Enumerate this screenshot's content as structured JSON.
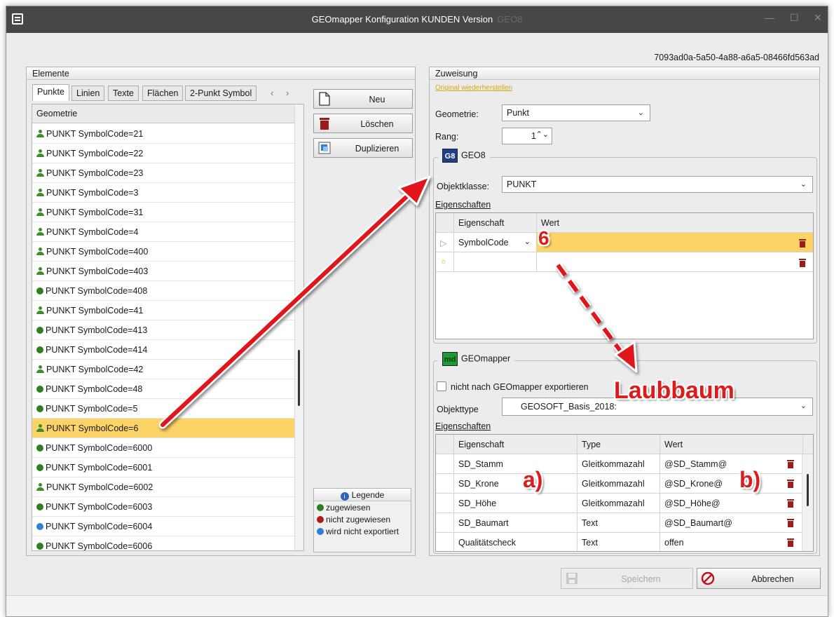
{
  "window": {
    "title": "GEOmapper Konfiguration KUNDEN Version",
    "title_suffix": "GEO8",
    "guid": "7093ad0a-5a50-4a88-a6a5-08466fd563ad"
  },
  "elements": {
    "header": "Elemente",
    "tabs": [
      "Punkte",
      "Linien",
      "Texte",
      "Flächen",
      "2-Punkt Symbol"
    ],
    "active_tab": "Punkte",
    "column_header": "Geometrie",
    "rows": [
      {
        "label": "PUNKT SymbolCode=21",
        "icon": "person",
        "color": "#3c8c28"
      },
      {
        "label": "PUNKT SymbolCode=22",
        "icon": "person",
        "color": "#3c8c28"
      },
      {
        "label": "PUNKT SymbolCode=23",
        "icon": "person",
        "color": "#3c8c28"
      },
      {
        "label": "PUNKT SymbolCode=3",
        "icon": "person",
        "color": "#3c8c28"
      },
      {
        "label": "PUNKT SymbolCode=31",
        "icon": "person",
        "color": "#3c8c28"
      },
      {
        "label": "PUNKT SymbolCode=4",
        "icon": "person",
        "color": "#3c8c28"
      },
      {
        "label": "PUNKT SymbolCode=400",
        "icon": "person",
        "color": "#3c8c28"
      },
      {
        "label": "PUNKT SymbolCode=403",
        "icon": "person",
        "color": "#3c8c28"
      },
      {
        "label": "PUNKT SymbolCode=408",
        "icon": "dot",
        "color": "#2e7d1e"
      },
      {
        "label": "PUNKT SymbolCode=41",
        "icon": "person",
        "color": "#3c8c28"
      },
      {
        "label": "PUNKT SymbolCode=413",
        "icon": "dot",
        "color": "#2e7d1e"
      },
      {
        "label": "PUNKT SymbolCode=414",
        "icon": "dot",
        "color": "#2e7d1e"
      },
      {
        "label": "PUNKT SymbolCode=42",
        "icon": "person",
        "color": "#3c8c28"
      },
      {
        "label": "PUNKT SymbolCode=48",
        "icon": "dot",
        "color": "#2e7d1e"
      },
      {
        "label": "PUNKT SymbolCode=5",
        "icon": "dot",
        "color": "#2e7d1e"
      },
      {
        "label": "PUNKT SymbolCode=6",
        "icon": "person",
        "color": "#3c8c28",
        "selected": true
      },
      {
        "label": "PUNKT SymbolCode=6000",
        "icon": "dot",
        "color": "#2e7d1e"
      },
      {
        "label": "PUNKT SymbolCode=6001",
        "icon": "dot",
        "color": "#2e7d1e"
      },
      {
        "label": "PUNKT SymbolCode=6002",
        "icon": "person",
        "color": "#3c8c28"
      },
      {
        "label": "PUNKT SymbolCode=6003",
        "icon": "dot",
        "color": "#2e7d1e"
      },
      {
        "label": "PUNKT SymbolCode=6004",
        "icon": "dot",
        "color": "#2f7fd6"
      },
      {
        "label": "PUNKT SymbolCode=6006",
        "icon": "dot",
        "color": "#2e7d1e"
      }
    ],
    "buttons": {
      "new": "Neu",
      "delete": "Löschen",
      "duplicate": "Duplizieren"
    },
    "legend": {
      "title": "Legende",
      "items": [
        {
          "label": "zugewiesen",
          "color": "#2e7d1e"
        },
        {
          "label": "nicht zugewiesen",
          "color": "#a81c1c"
        },
        {
          "label": "wird nicht exportiert",
          "color": "#2f7fd6"
        }
      ]
    }
  },
  "assignment": {
    "header": "Zuweisung",
    "restore_link": "Original wiederherstellen",
    "geometry_label": "Geometrie:",
    "geometry_value": "Punkt",
    "rank_label": "Rang:",
    "rank_value": "1",
    "geo8": {
      "title": "GEO8",
      "badge": "G8",
      "objektklasse_label": "Objektklasse:",
      "objektklasse_value": "PUNKT",
      "properties_label": "Eigenschaften",
      "col_property": "Eigenschaft",
      "col_value": "Wert",
      "row_property": "SymbolCode",
      "row_value": "6"
    },
    "geomapper": {
      "title": "GEOmapper",
      "badge": "md",
      "no_export_label": "nicht nach GEOmapper exportieren",
      "objekttype_label": "Objekttype",
      "objekttype_value": "GEOSOFT_Basis_2018:",
      "objekttype_overlay": "Laubbaum",
      "properties_label": "Eigenschaften",
      "columns": [
        "Eigenschaft",
        "Type",
        "Wert"
      ],
      "rows": [
        {
          "property": "SD_Stamm",
          "type": "Gleitkommazahl",
          "value": "@SD_Stamm@"
        },
        {
          "property": "SD_Krone",
          "type": "Gleitkommazahl",
          "value": "@SD_Krone@"
        },
        {
          "property": "SD_Höhe",
          "type": "Gleitkommazahl",
          "value": "@SD_Höhe@"
        },
        {
          "property": "SD_Baumart",
          "type": "Text",
          "value": "@SD_Baumart@"
        },
        {
          "property": "Qualitätscheck",
          "type": "Text",
          "value": "offen"
        }
      ]
    }
  },
  "footer": {
    "save": "Speichern",
    "cancel": "Abbrechen"
  },
  "annotations": {
    "a": "a)",
    "b": "b)"
  }
}
